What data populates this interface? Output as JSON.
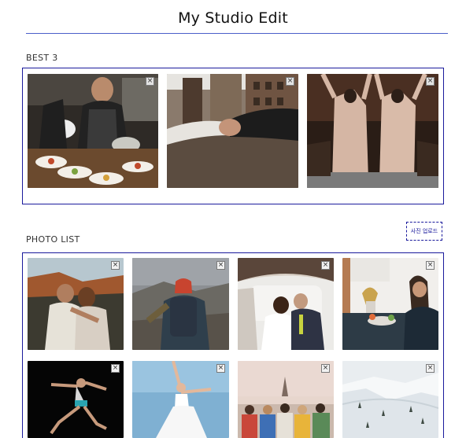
{
  "page": {
    "title": "My Studio Edit"
  },
  "best": {
    "label": "BEST 3",
    "photos": [
      {
        "subject": "chef plating food",
        "remove_icon": "close-icon"
      },
      {
        "subject": "fist bump on street",
        "remove_icon": "close-icon"
      },
      {
        "subject": "graduates celebrating",
        "remove_icon": "close-icon"
      }
    ]
  },
  "list": {
    "label": "PHOTO LIST",
    "upload_label": "사진 업로드",
    "photos": [
      {
        "subject": "couple embracing outdoors",
        "remove_icon": "close-icon"
      },
      {
        "subject": "hiker on mountain",
        "remove_icon": "close-icon"
      },
      {
        "subject": "wedding couple in car",
        "remove_icon": "close-icon"
      },
      {
        "subject": "woman in kitchen",
        "remove_icon": "close-icon"
      },
      {
        "subject": "dancer leaping",
        "remove_icon": "close-icon"
      },
      {
        "subject": "ballerina in white dress",
        "remove_icon": "close-icon"
      },
      {
        "subject": "friends in paris",
        "remove_icon": "close-icon"
      },
      {
        "subject": "snowy mountain ski slope",
        "remove_icon": "close-icon"
      }
    ]
  },
  "colors": {
    "accent": "#1a1a9c",
    "rule": "#4a5fc9"
  }
}
